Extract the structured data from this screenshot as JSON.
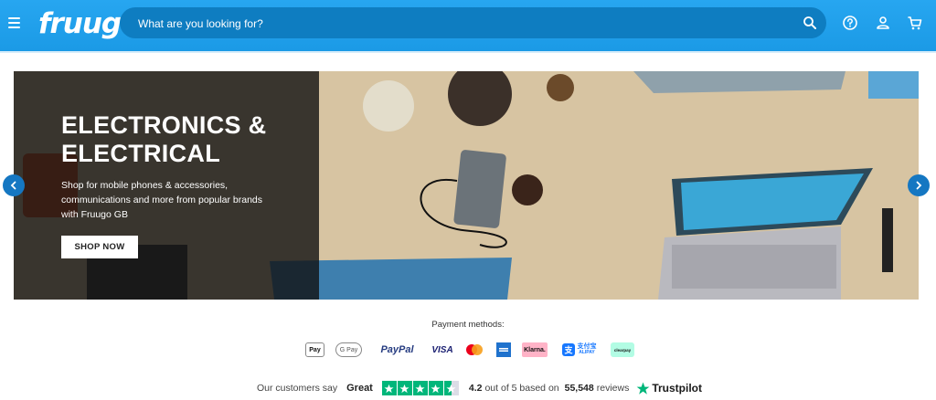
{
  "header": {
    "logo": "fruugo",
    "search_placeholder": "What are you looking for?"
  },
  "hero": {
    "title": "ELECTRONICS &\nELECTRICAL",
    "description": "Shop for mobile phones & accessories, communications and more from popular brands with Fruugo GB",
    "cta": "SHOP NOW"
  },
  "payments": {
    "title": "Payment methods:",
    "methods": {
      "applepay": "Pay",
      "gpay": "G Pay",
      "paypal": "PayPal",
      "visa": "VISA",
      "klarna": "Klarna.",
      "alipay_cn": "支付宝",
      "alipay": "ALIPAY",
      "clearpay": "clearpay"
    }
  },
  "trustpilot": {
    "prefix": "Our customers say",
    "rating_word": "Great",
    "stars": 4.5,
    "score": "4.2",
    "out_of": "out of 5 based on",
    "count": "55,548",
    "reviews_label": "reviews",
    "brand": "Trustpilot"
  },
  "colors": {
    "header": "#1da1f2",
    "search_bg": "#0e7dc1",
    "arrow": "#1577c2",
    "trustpilot_green": "#00b67a"
  }
}
